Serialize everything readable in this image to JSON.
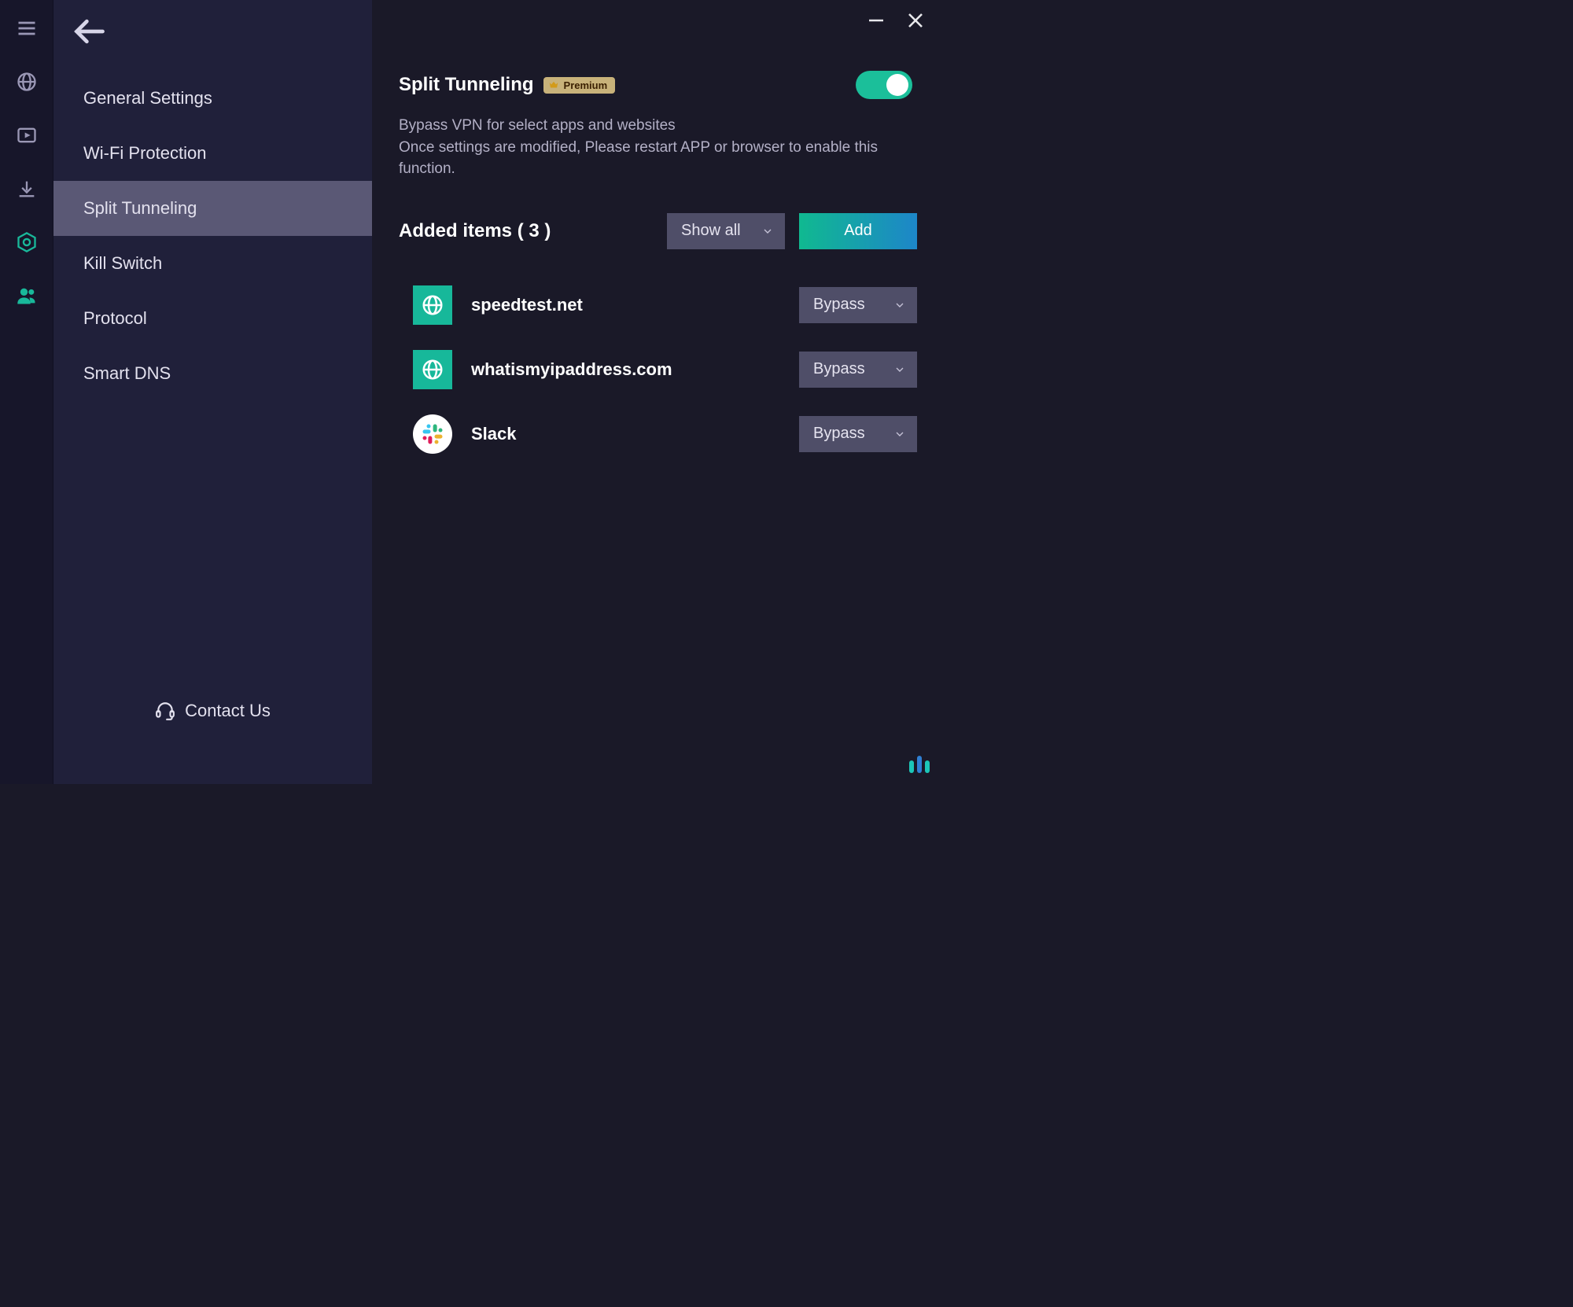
{
  "sidebar": {
    "items": [
      {
        "label": "General Settings"
      },
      {
        "label": "Wi-Fi Protection"
      },
      {
        "label": "Split Tunneling",
        "selected": true
      },
      {
        "label": "Kill Switch"
      },
      {
        "label": "Protocol"
      },
      {
        "label": "Smart DNS"
      }
    ],
    "contact_label": "Contact Us"
  },
  "main": {
    "title": "Split Tunneling",
    "premium_label": "Premium",
    "toggle_on": true,
    "description_line1": "Bypass VPN for select apps and websites",
    "description_line2": "Once settings are modified, Please restart APP or browser to enable this function.",
    "items_header": "Added items ( 3 )",
    "filter_label": "Show all",
    "add_label": "Add",
    "items": [
      {
        "name": "speedtest.net",
        "icon": "globe",
        "action": "Bypass"
      },
      {
        "name": "whatismyipaddress.com",
        "icon": "globe",
        "action": "Bypass"
      },
      {
        "name": "Slack",
        "icon": "slack",
        "action": "Bypass"
      }
    ]
  }
}
